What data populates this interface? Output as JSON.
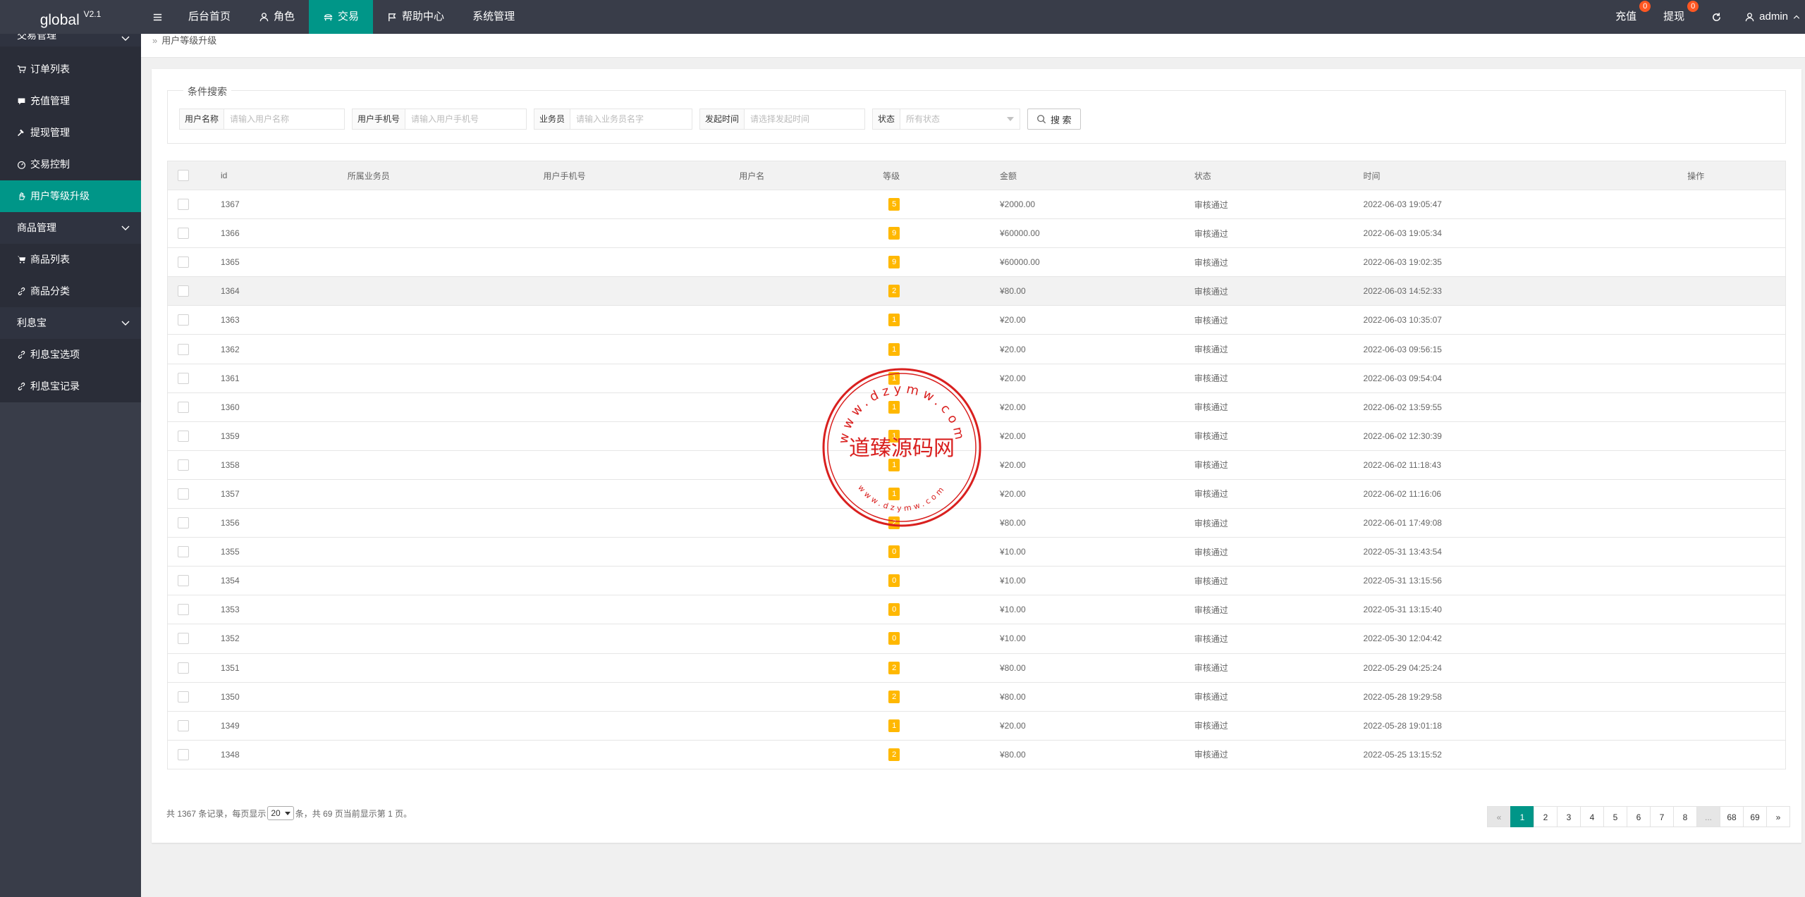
{
  "header": {
    "logo": "global",
    "version": "V2.1",
    "nav": [
      {
        "label": "后台首页",
        "icon": ""
      },
      {
        "label": "角色",
        "icon": "user-icon"
      },
      {
        "label": "交易",
        "icon": "transaction-icon"
      },
      {
        "label": "帮助中心",
        "icon": "flag-icon"
      },
      {
        "label": "系统管理",
        "icon": ""
      }
    ],
    "active_nav": "交易",
    "right": {
      "recharge_label": "充值",
      "recharge_count": "0",
      "withdraw_label": "提现",
      "withdraw_count": "0",
      "user_label": "admin"
    }
  },
  "sidebar": {
    "group1": "交易管理",
    "items1": [
      "订单列表",
      "充值管理",
      "提现管理",
      "交易控制",
      "用户等级升级"
    ],
    "active": "用户等级升级",
    "group2": "商品管理",
    "items2": [
      "商品列表",
      "商品分类"
    ],
    "group3": "利息宝",
    "items3": [
      "利息宝选项",
      "利息宝记录"
    ]
  },
  "breadcrumb": "用户等级升级",
  "search": {
    "legend": "条件搜索",
    "username_label": "用户名称",
    "username_placeholder": "请输入用户名称",
    "phone_label": "用户手机号",
    "phone_placeholder": "请输入用户手机号",
    "agent_label": "业务员",
    "agent_placeholder": "请输入业务员名字",
    "time_label": "发起时间",
    "time_placeholder": "请选择发起时间",
    "status_label": "状态",
    "status_value": "所有状态",
    "button": "搜 索"
  },
  "table": {
    "columns": [
      "id",
      "所属业务员",
      "用户手机号",
      "用户名",
      "等级",
      "金额",
      "状态",
      "时间",
      "操作"
    ],
    "rows": [
      {
        "id": "1367",
        "level": "5",
        "amount": "¥2000.00",
        "status": "审核通过",
        "time": "2022-06-03 19:05:47"
      },
      {
        "id": "1366",
        "level": "9",
        "amount": "¥60000.00",
        "status": "审核通过",
        "time": "2022-06-03 19:05:34"
      },
      {
        "id": "1365",
        "level": "9",
        "amount": "¥60000.00",
        "status": "审核通过",
        "time": "2022-06-03 19:02:35"
      },
      {
        "id": "1364",
        "level": "2",
        "amount": "¥80.00",
        "status": "审核通过",
        "time": "2022-06-03 14:52:33"
      },
      {
        "id": "1363",
        "level": "1",
        "amount": "¥20.00",
        "status": "审核通过",
        "time": "2022-06-03 10:35:07"
      },
      {
        "id": "1362",
        "level": "1",
        "amount": "¥20.00",
        "status": "审核通过",
        "time": "2022-06-03 09:56:15"
      },
      {
        "id": "1361",
        "level": "1",
        "amount": "¥20.00",
        "status": "审核通过",
        "time": "2022-06-03 09:54:04"
      },
      {
        "id": "1360",
        "level": "1",
        "amount": "¥20.00",
        "status": "审核通过",
        "time": "2022-06-02 13:59:55"
      },
      {
        "id": "1359",
        "level": "1",
        "amount": "¥20.00",
        "status": "审核通过",
        "time": "2022-06-02 12:30:39"
      },
      {
        "id": "1358",
        "level": "1",
        "amount": "¥20.00",
        "status": "审核通过",
        "time": "2022-06-02 11:18:43"
      },
      {
        "id": "1357",
        "level": "1",
        "amount": "¥20.00",
        "status": "审核通过",
        "time": "2022-06-02 11:16:06"
      },
      {
        "id": "1356",
        "level": "2",
        "amount": "¥80.00",
        "status": "审核通过",
        "time": "2022-06-01 17:49:08"
      },
      {
        "id": "1355",
        "level": "0",
        "amount": "¥10.00",
        "status": "审核通过",
        "time": "2022-05-31 13:43:54"
      },
      {
        "id": "1354",
        "level": "0",
        "amount": "¥10.00",
        "status": "审核通过",
        "time": "2022-05-31 13:15:56"
      },
      {
        "id": "1353",
        "level": "0",
        "amount": "¥10.00",
        "status": "审核通过",
        "time": "2022-05-31 13:15:40"
      },
      {
        "id": "1352",
        "level": "0",
        "amount": "¥10.00",
        "status": "审核通过",
        "time": "2022-05-30 12:04:42"
      },
      {
        "id": "1351",
        "level": "2",
        "amount": "¥80.00",
        "status": "审核通过",
        "time": "2022-05-29 04:25:24"
      },
      {
        "id": "1350",
        "level": "2",
        "amount": "¥80.00",
        "status": "审核通过",
        "time": "2022-05-28 19:29:58"
      },
      {
        "id": "1349",
        "level": "1",
        "amount": "¥20.00",
        "status": "审核通过",
        "time": "2022-05-28 19:01:18"
      },
      {
        "id": "1348",
        "level": "2",
        "amount": "¥80.00",
        "status": "审核通过",
        "time": "2022-05-25 13:15:52"
      }
    ]
  },
  "pagination": {
    "info_prefix": "共 1367 条记录，每页显示",
    "page_size": "20",
    "info_suffix": "条，共 69 页当前显示第 1 页。",
    "prev": "«",
    "pages": [
      "1",
      "2",
      "3",
      "4",
      "5",
      "6",
      "7",
      "8",
      "...",
      "68",
      "69"
    ],
    "current": "1",
    "next": "»"
  },
  "watermark": {
    "ring_top": "www.dzymw.com",
    "center": "道臻源码网",
    "ring_bottom": "www.dzymw.com",
    "color": "#d9201f"
  },
  "colors": {
    "header_bg": "#393d49",
    "accent": "#009688",
    "badge": "#ff5722",
    "level_badge": "#ffb800"
  }
}
